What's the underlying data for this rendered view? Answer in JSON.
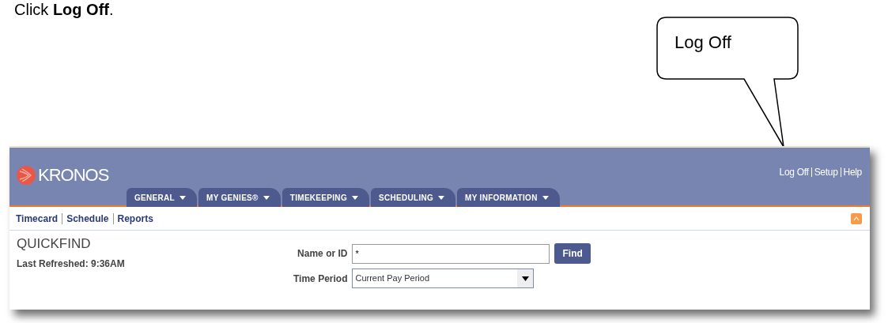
{
  "instruction": "Click **Log Off**.",
  "callout": {
    "text": "Log Off"
  },
  "app": {
    "logo": "KRONOS",
    "header_links": [
      "Log Off",
      "Setup",
      "Help"
    ],
    "tabs": [
      {
        "label": "GENERAL"
      },
      {
        "label": "MY GENIES®"
      },
      {
        "label": "TIMEKEEPING"
      },
      {
        "label": "SCHEDULING"
      },
      {
        "label": "MY INFORMATION"
      }
    ],
    "subnav": [
      "Timecard",
      "Schedule",
      "Reports"
    ],
    "quickfind": {
      "title": "QUICKFIND",
      "last_refreshed": "Last Refreshed: 9:36AM",
      "name_label": "Name or ID",
      "name_value": "*",
      "find_button": "Find",
      "period_label": "Time Period",
      "period_value": "Current Pay Period"
    }
  }
}
